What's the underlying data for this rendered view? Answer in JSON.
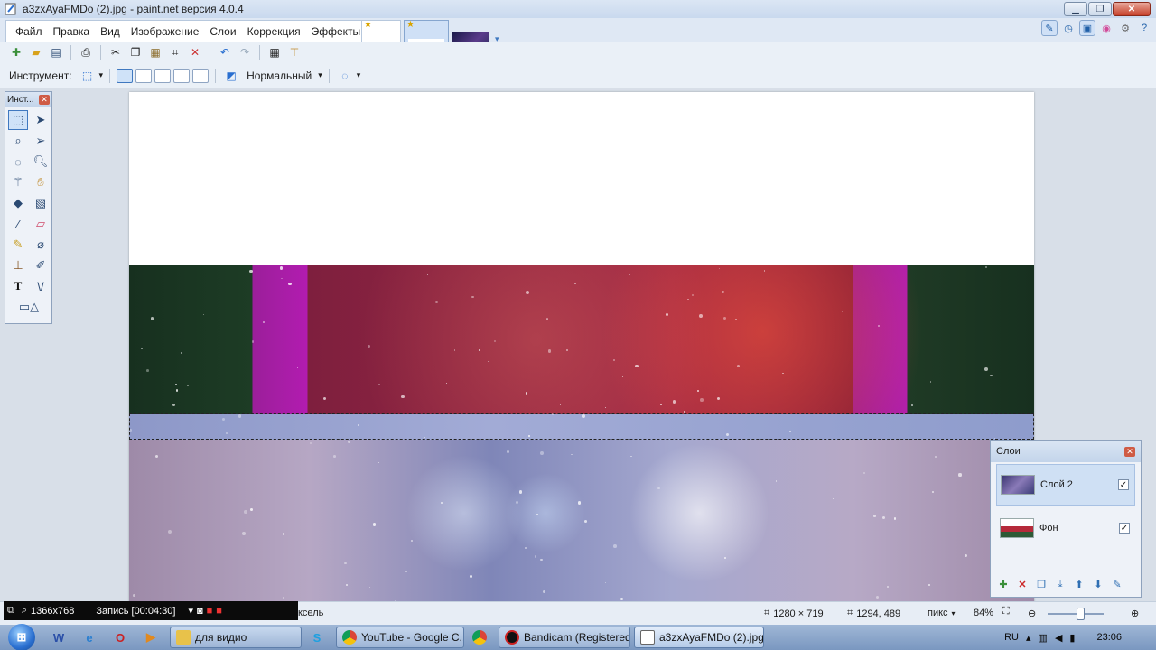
{
  "window": {
    "title": "a3zxAyaFMDo (2).jpg - paint.net версия 4.0.4"
  },
  "menu": {
    "items": [
      "Файл",
      "Правка",
      "Вид",
      "Изображение",
      "Слои",
      "Коррекция",
      "Эффекты"
    ]
  },
  "toolbar2": {
    "tool_label": "Инструмент:",
    "blend_mode": "Нормальный"
  },
  "tools_window": {
    "title": "Инст...",
    "tools": [
      "rectangle-select",
      "move-selection",
      "lasso-select",
      "move-selected",
      "ellipse-select",
      "zoom",
      "magic-wand",
      "pan",
      "paint-bucket",
      "gradient",
      "paintbrush",
      "eraser",
      "pencil",
      "color-picker",
      "clone-stamp",
      "recolor",
      "text",
      "line-curve",
      "shapes"
    ]
  },
  "layers_window": {
    "title": "Слои",
    "layers": [
      {
        "name": "Слой 2",
        "visible": true,
        "selected": true
      },
      {
        "name": "Фон",
        "visible": true,
        "selected": false
      }
    ]
  },
  "status": {
    "units_fragment": "ксель",
    "image_size": "1280 × 719",
    "cursor_pos": "1294, 489",
    "units": "пикс",
    "zoom": "84%",
    "zoom_fraction": 0.58
  },
  "bandicam": {
    "resolution": "1366x768",
    "recording": "Запись [00:04:30]"
  },
  "taskbar": {
    "tasks": [
      {
        "label": "для видио",
        "active": false
      },
      {
        "label": "YouTube - Google C...",
        "active": false
      },
      {
        "label": "Bandicam (Registered)",
        "active": false
      },
      {
        "label": "a3zxAyaFMDo (2).jpg...",
        "active": true
      }
    ],
    "lang": "RU",
    "time": "23:06"
  },
  "colors": {
    "accent": "#3f78c0",
    "close": "#c6402a"
  }
}
